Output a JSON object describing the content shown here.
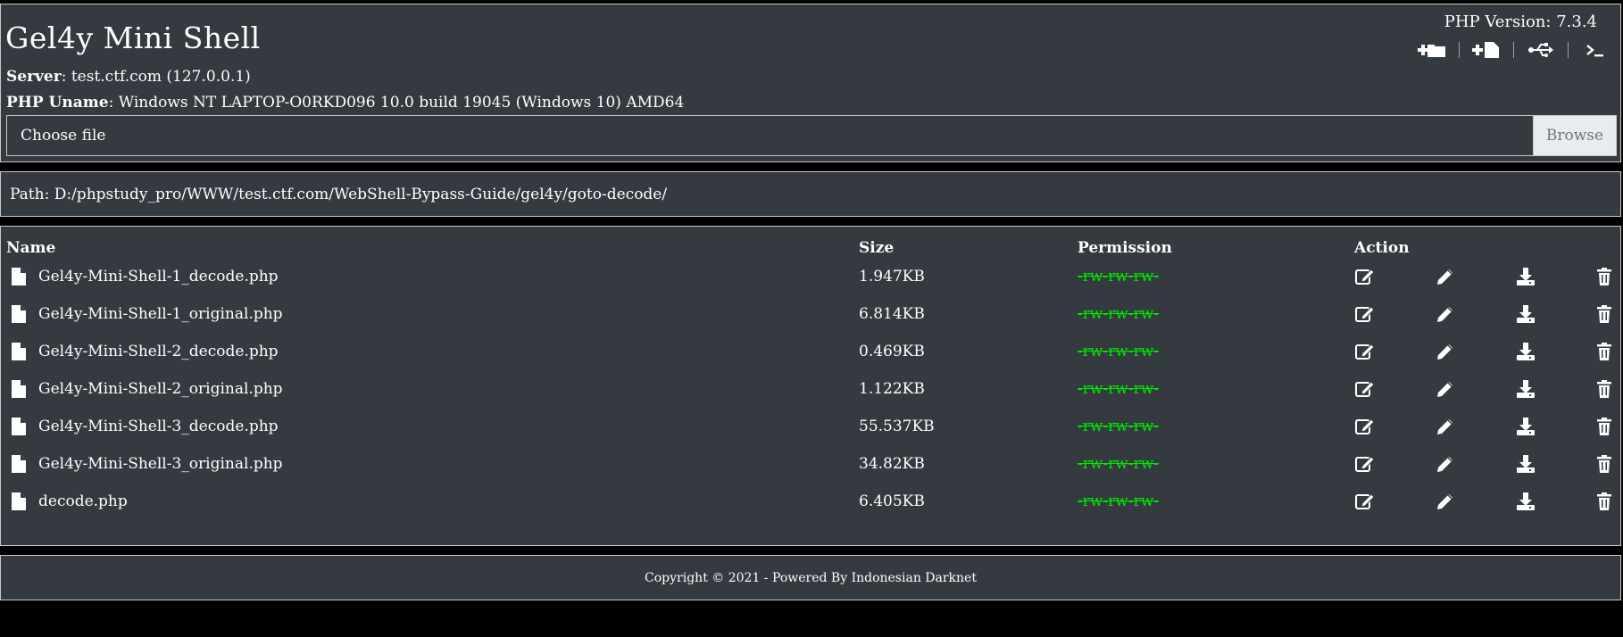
{
  "header": {
    "title": "Gel4y Mini Shell",
    "php_version": "PHP Version: 7.3.4",
    "toolbar_icons": [
      "folder-plus-icon",
      "file-plus-icon",
      "usb-icon",
      "terminal-icon"
    ],
    "server_label": "Server",
    "server_value": ": test.ctf.com (127.0.0.1)",
    "uname_label": "PHP Uname",
    "uname_value": ": Windows NT LAPTOP-O0RKD096 10.0 build 19045 (Windows 10) AMD64",
    "file_placeholder": "Choose file",
    "browse_label": "Browse"
  },
  "path": {
    "text": "Path: D:/phpstudy_pro/WWW/test.ctf.com/WebShell-Bypass-Guide/gel4y/goto-decode/"
  },
  "table": {
    "columns": [
      "Name",
      "Size",
      "Permission",
      "Action"
    ],
    "rows": [
      {
        "name": "Gel4y-Mini-Shell-1_decode.php",
        "size": "1.947KB",
        "permission": "-rw-rw-rw-"
      },
      {
        "name": "Gel4y-Mini-Shell-1_original.php",
        "size": "6.814KB",
        "permission": "-rw-rw-rw-"
      },
      {
        "name": "Gel4y-Mini-Shell-2_decode.php",
        "size": "0.469KB",
        "permission": "-rw-rw-rw-"
      },
      {
        "name": "Gel4y-Mini-Shell-2_original.php",
        "size": "1.122KB",
        "permission": "-rw-rw-rw-"
      },
      {
        "name": "Gel4y-Mini-Shell-3_decode.php",
        "size": "55.537KB",
        "permission": "-rw-rw-rw-"
      },
      {
        "name": "Gel4y-Mini-Shell-3_original.php",
        "size": "34.82KB",
        "permission": "-rw-rw-rw-"
      },
      {
        "name": "decode.php",
        "size": "6.405KB",
        "permission": "-rw-rw-rw-"
      }
    ],
    "action_icons": [
      "rename-icon",
      "edit-icon",
      "download-icon",
      "delete-icon"
    ]
  },
  "footer": {
    "copyright": "Copyright © 2021 - Powered By Indonesian Darknet"
  },
  "colors": {
    "panel_bg": "#343a40",
    "permission_green": "#00e600",
    "border": "#c8c8c8"
  }
}
